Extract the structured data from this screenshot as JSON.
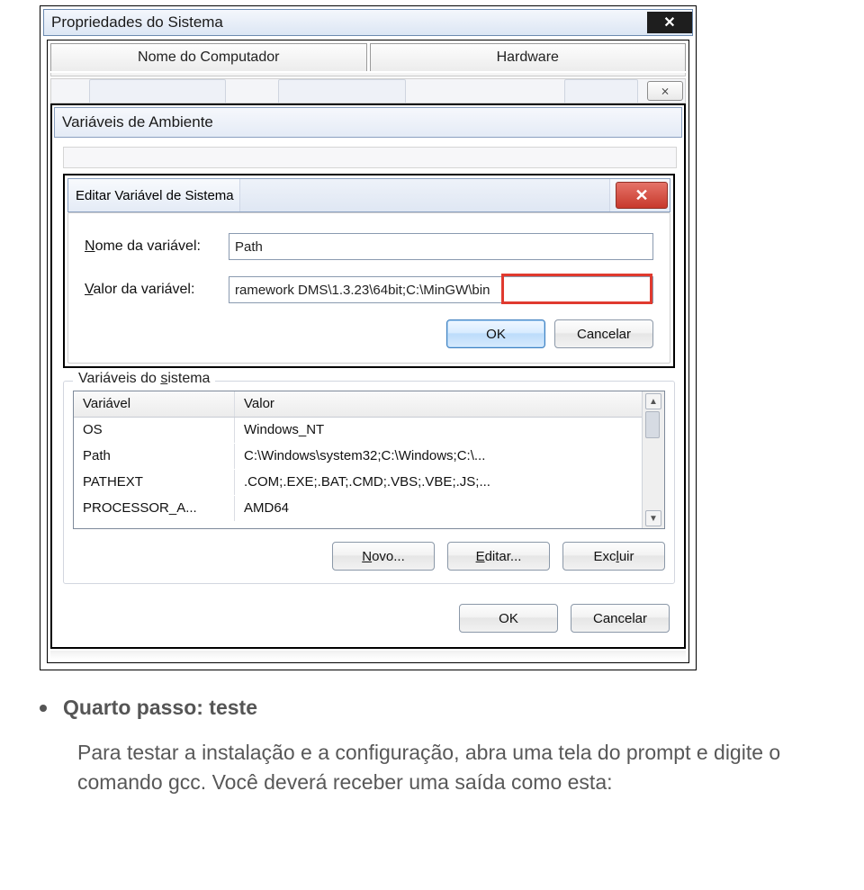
{
  "dialog": {
    "system_properties_title": "Propriedades do Sistema",
    "tabs": {
      "computer_name": "Nome do Computador",
      "hardware": "Hardware"
    },
    "env_vars_title": "Variáveis de Ambiente",
    "secondary_close": "⨯",
    "edit_var": {
      "title": "Editar Variável de Sistema",
      "name_label_pre": "N",
      "name_label_post": "ome da variável:",
      "value_label_pre": "V",
      "value_label_post": "alor da variável:",
      "name_value": "Path",
      "value_value": "ramework DMS\\1.3.23\\64bit;C:\\MinGW\\bin",
      "ok": "OK",
      "cancel": "Cancelar"
    },
    "sys_vars": {
      "group_label_pre": "Variáveis do ",
      "group_label_u": "s",
      "group_label_post": "istema",
      "col_var": "Variável",
      "col_val": "Valor",
      "rows": [
        {
          "var": "OS",
          "val": "Windows_NT"
        },
        {
          "var": "Path",
          "val": "C:\\Windows\\system32;C:\\Windows;C:\\..."
        },
        {
          "var": "PATHEXT",
          "val": ".COM;.EXE;.BAT;.CMD;.VBS;.VBE;.JS;..."
        },
        {
          "var": "PROCESSOR_A...",
          "val": "AMD64"
        }
      ],
      "new_btn": "Novo...",
      "edit_btn": "Editar...",
      "delete_btn_pre": "Exc",
      "delete_btn_u": "l",
      "delete_btn_post": "uir"
    },
    "bottom": {
      "ok": "OK",
      "cancel": "Cancelar"
    }
  },
  "article": {
    "step_title": "Quarto passo: teste",
    "step_text": "Para testar a instalação e a configuração, abra uma tela do prompt e digite o comando gcc. Você deverá receber uma saída como esta:"
  }
}
